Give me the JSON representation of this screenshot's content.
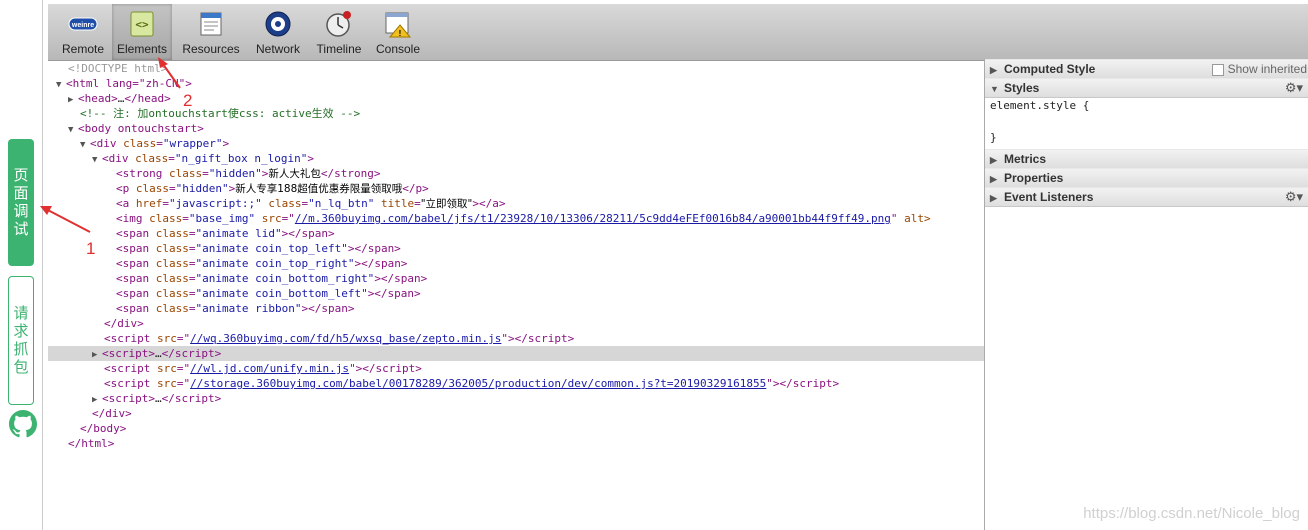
{
  "sidebar": {
    "debug_tab": "页面调试",
    "capture_tab": "请求抓包",
    "github_icon": "github-icon"
  },
  "toolbar": {
    "tools": [
      {
        "label": "Remote",
        "icon": "weinre-logo-icon"
      },
      {
        "label": "Elements",
        "icon": "elements-icon",
        "active": true
      },
      {
        "label": "Resources",
        "icon": "resources-icon"
      },
      {
        "label": "Network",
        "icon": "network-icon"
      },
      {
        "label": "Timeline",
        "icon": "timeline-icon"
      },
      {
        "label": "Console",
        "icon": "console-icon"
      }
    ]
  },
  "dom": {
    "doctype": "<!DOCTYPE html>",
    "l_html": "<html lang=\"zh-CN\">",
    "l_head_tag": "<head>",
    "l_head_close": "</head>",
    "l_comment": "<!-- 注: 加ontouchstart使css: active生效 -->",
    "l_body": "<body ontouchstart>",
    "wrapper": "\"wrapper\"",
    "giftbox": "\"n_gift_box n_login\"",
    "strong_text": "新人大礼包",
    "p_text": "新人专享188超值优惠券限量领取哦",
    "a_href": "\"javascript:;\"",
    "a_class": "\"n_lq_btn\"",
    "a_title": "\"立即领取\"",
    "img_class": "\"base_img\"",
    "img_src": "//m.360buyimg.com/babel/jfs/t1/23928/10/13306/28211/5c9dd4eFEf0016b84/a90001bb44f9ff49.png",
    "span_classes": [
      "\"animate lid\"",
      "\"animate coin_top_left\"",
      "\"animate coin_top_right\"",
      "\"animate coin_bottom_right\"",
      "\"animate coin_bottom_left\"",
      "\"animate ribbon\""
    ],
    "script1_src": "//wq.360buyimg.com/fd/h5/wxsq_base/zepto.min.js",
    "script2_src": "//wl.jd.com/unify.min.js",
    "script3_src": "//storage.360buyimg.com/babel/00178289/362005/production/dev/common.js?t=20190329161855",
    "hidden_class": "\"hidden\""
  },
  "right_panel": {
    "computed_style": "Computed Style",
    "show_inherited": "Show inherited",
    "styles": "Styles",
    "element_style": "element.style {",
    "close_brace": "}",
    "metrics": "Metrics",
    "properties": "Properties",
    "event_listeners": "Event Listeners"
  },
  "annotations": {
    "one": "1",
    "two": "2"
  },
  "watermark": "https://blog.csdn.net/Nicole_blog",
  "colors": {
    "accent": "#3cb371",
    "annotation": "#e03030"
  }
}
